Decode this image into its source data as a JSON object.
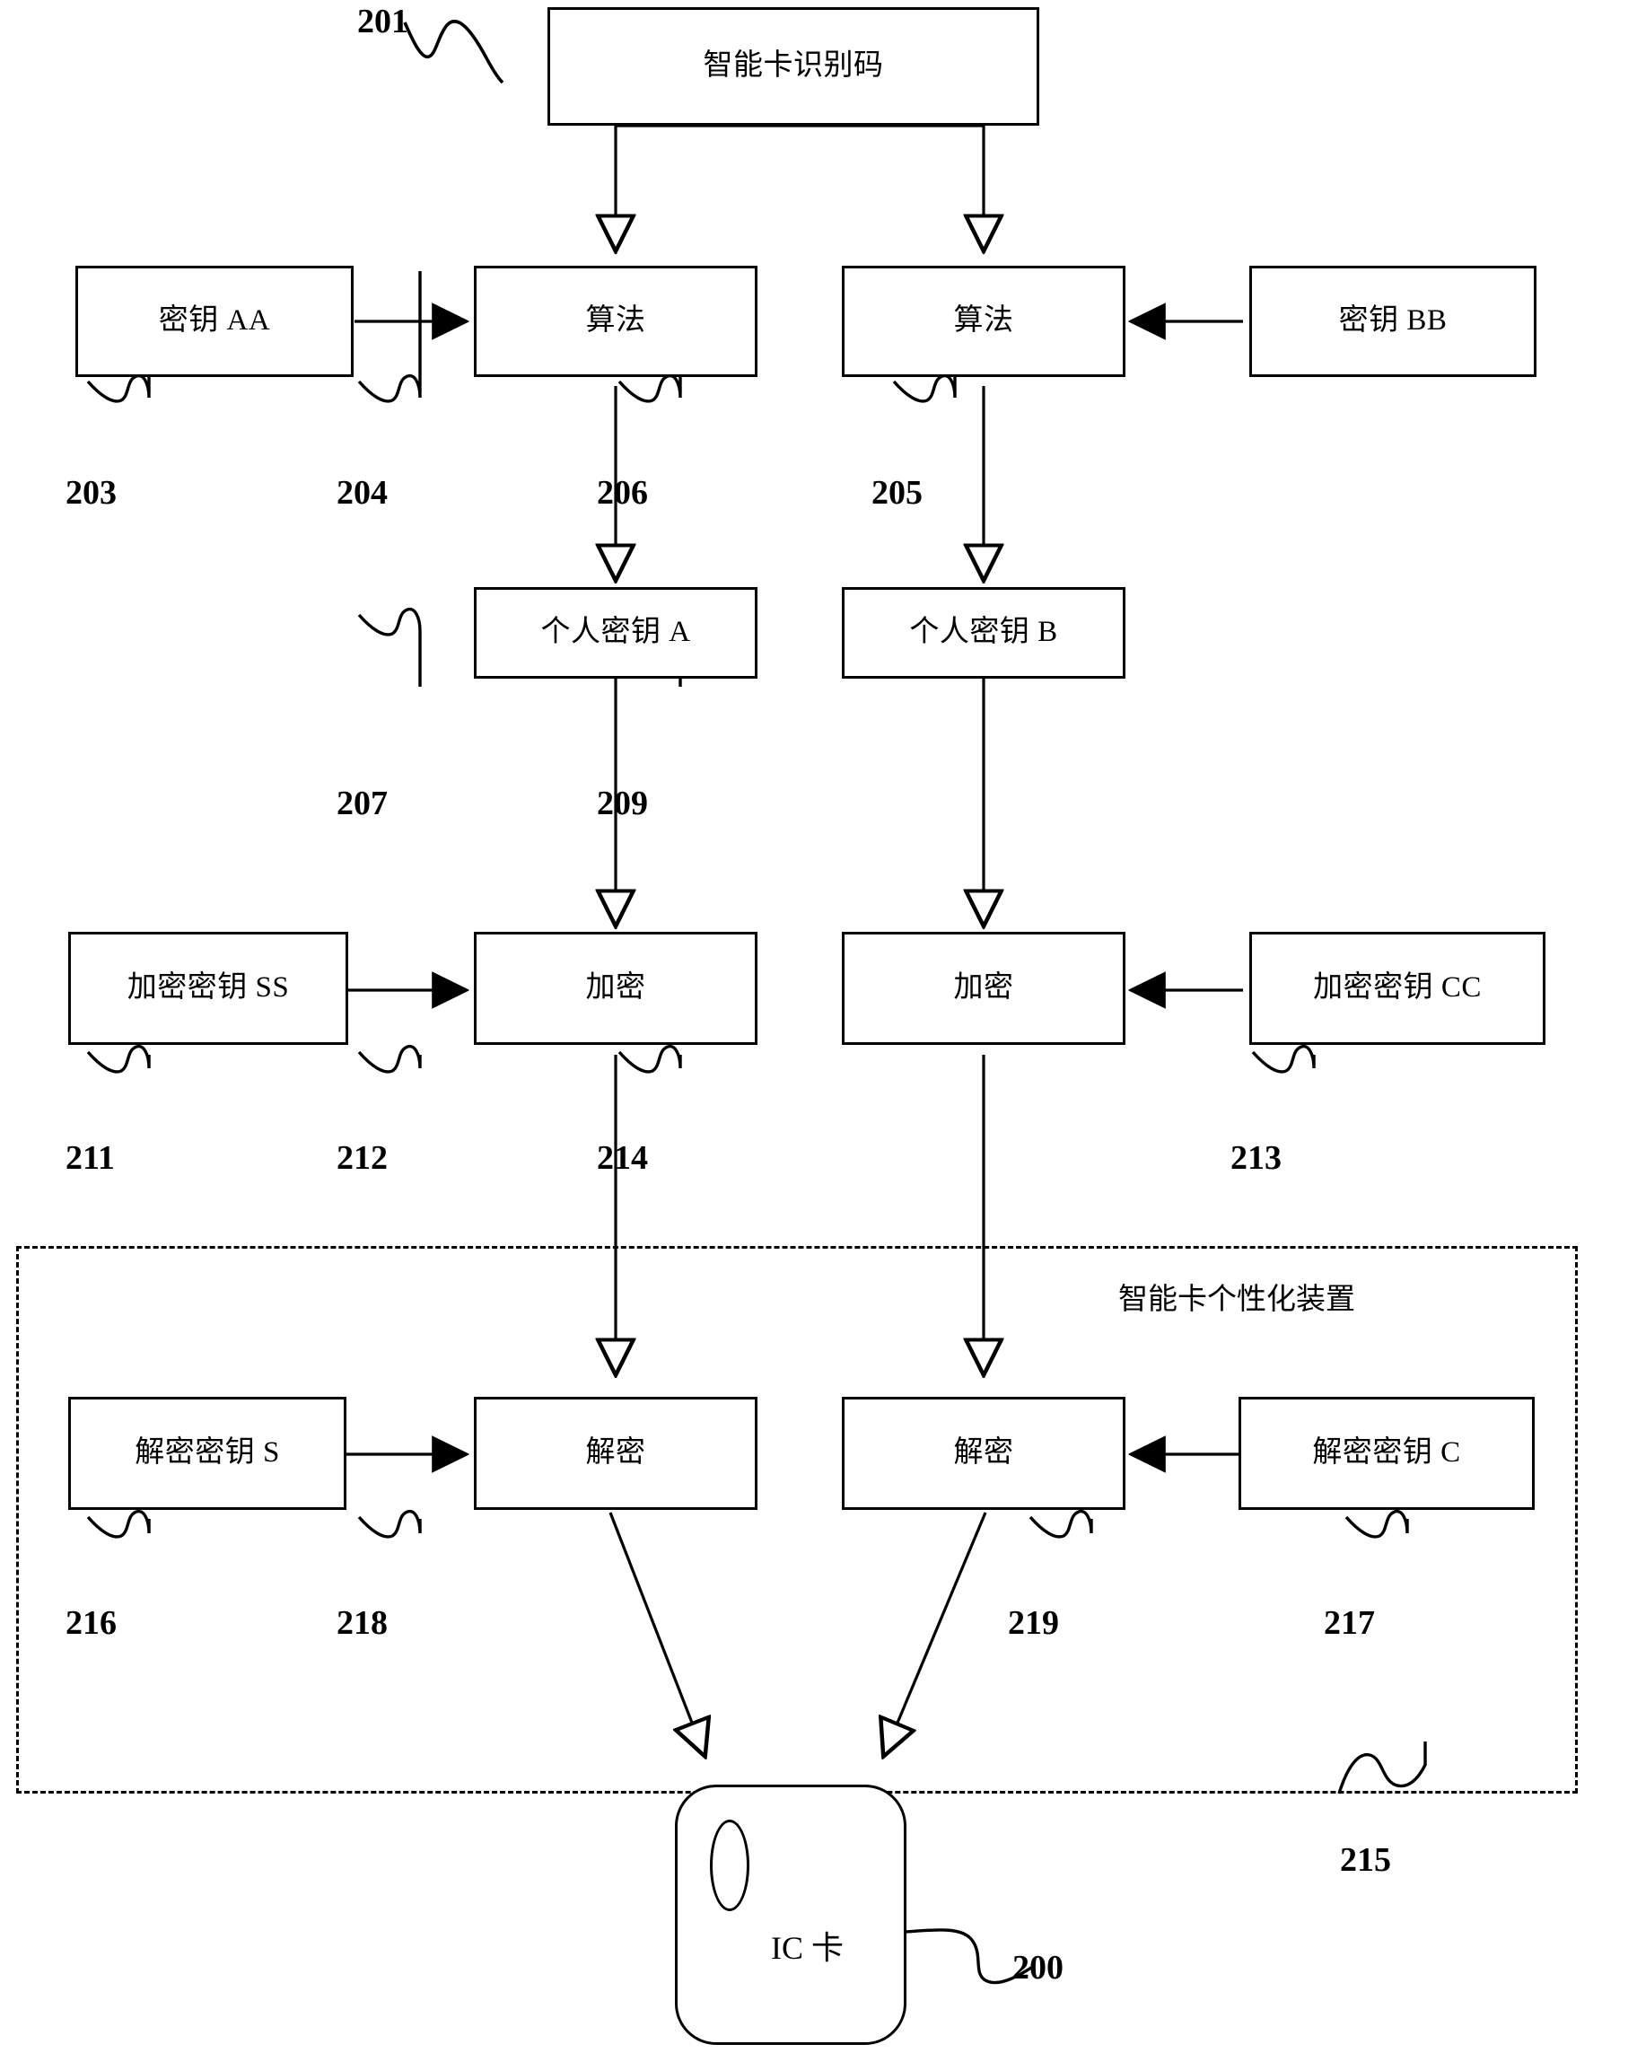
{
  "figure": {
    "type": "patent-flow-diagram",
    "language": "zh",
    "region": {
      "title": "智能卡个性化装置",
      "ref": "215"
    },
    "nodes": [
      {
        "id": "n201",
        "label": "智能卡识别码",
        "ref": "201"
      },
      {
        "id": "n203",
        "label": "密钥 AA",
        "ref": "203"
      },
      {
        "id": "n204",
        "label": "算法",
        "ref": "204"
      },
      {
        "id": "n206",
        "label": "算法",
        "ref": "206"
      },
      {
        "id": "n205",
        "label": "密钥 BB",
        "ref": "205"
      },
      {
        "id": "n207",
        "label": "个人密钥 A",
        "ref": "207"
      },
      {
        "id": "n209",
        "label": "个人密钥 B",
        "ref": "209"
      },
      {
        "id": "n211",
        "label": "加密密钥 SS",
        "ref": "211"
      },
      {
        "id": "n212",
        "label": "加密",
        "ref": "212"
      },
      {
        "id": "n214",
        "label": "加密",
        "ref": "214"
      },
      {
        "id": "n213",
        "label": "加密密钥 CC",
        "ref": "213"
      },
      {
        "id": "n216",
        "label": "解密密钥 S",
        "ref": "216"
      },
      {
        "id": "n218",
        "label": "解密",
        "ref": "218"
      },
      {
        "id": "n219",
        "label": "解密",
        "ref": "219"
      },
      {
        "id": "n217",
        "label": "解密密钥 C",
        "ref": "217"
      },
      {
        "id": "n200",
        "label": "IC 卡",
        "ref": "200"
      }
    ],
    "refs": {
      "r201": "201",
      "r203": "203",
      "r204": "204",
      "r206": "206",
      "r205": "205",
      "r207": "207",
      "r209": "209",
      "r211": "211",
      "r212": "212",
      "r214": "214",
      "r213": "213",
      "r216": "216",
      "r218": "218",
      "r219": "219",
      "r217": "217",
      "r215": "215",
      "r200": "200"
    },
    "labels": {
      "smartcard_id": "智能卡识别码",
      "key_aa": "密钥 AA",
      "key_bb": "密钥 BB",
      "algorithm_left": "算法",
      "algorithm_right": "算法",
      "personal_key_a": "个人密钥 A",
      "personal_key_b": "个人密钥 B",
      "enc_key_ss": "加密密钥 SS",
      "enc_key_cc": "加密密钥 CC",
      "encrypt_left": "加密",
      "encrypt_right": "加密",
      "dec_key_s": "解密密钥 S",
      "dec_key_c": "解密密钥 C",
      "decrypt_left": "解密",
      "decrypt_right": "解密",
      "device_title": "智能卡个性化装置",
      "ic_card": "IC 卡"
    }
  }
}
